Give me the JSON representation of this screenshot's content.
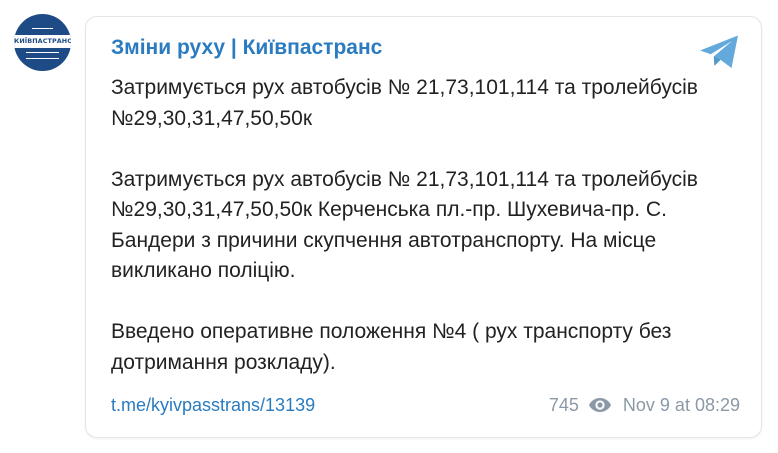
{
  "channel": {
    "name": "Зміни руху | Київпастранс",
    "avatar_text": "КИЇВПАСТРАНС"
  },
  "message": {
    "paragraphs": [
      "Затримується рух автобусів № 21,73,101,114 та тролейбусів №29,30,31,47,50,50к",
      "Затримується рух автобусів № 21,73,101,114 та тролейбусів №29,30,31,47,50,50к Керченська пл.-пр. Шухевича-пр. С. Бандери з причини скупчення автотранспорту. На місце викликано поліцію.",
      "Введено оперативне положення №4 ( рух транспорту без дотримання розкладу)."
    ]
  },
  "footer": {
    "link": "t.me/kyivpasstrans/13139",
    "views": "745",
    "date": "Nov 9 at 08:29"
  },
  "icons": {
    "share": "telegram-plane-icon",
    "views": "eye-icon"
  },
  "colors": {
    "accent": "#2a7bbf",
    "text": "#222222",
    "muted": "#8b99a6",
    "avatar_bg": "#1e4b86",
    "telegram_icon": "#64a9dc"
  }
}
